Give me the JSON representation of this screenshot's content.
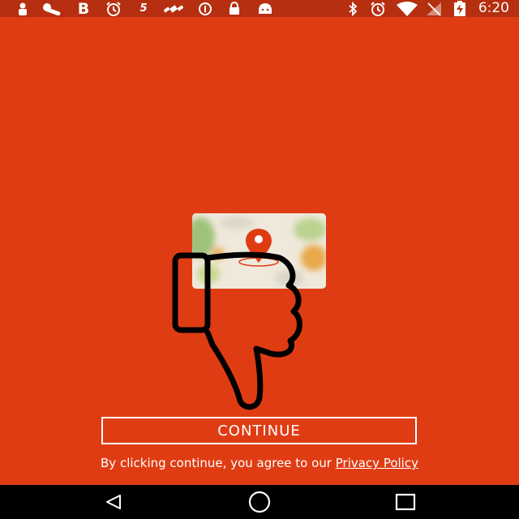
{
  "status_bar": {
    "time": "6:20",
    "left_icons": [
      "person-icon",
      "wrench-icon",
      "b-icon",
      "alarm-icon",
      "five-icon",
      "satellite-icon",
      "info-icon",
      "lock-icon",
      "android-icon"
    ],
    "right_icons": [
      "bluetooth-icon",
      "alarm-icon",
      "wifi-icon",
      "signal-off-icon",
      "battery-charging-icon"
    ],
    "left_glyphs": {
      "b": "B",
      "five": "5"
    }
  },
  "main": {
    "continue_label": "CONTINUE",
    "legal_prefix": "By clicking continue, you agree to our ",
    "privacy_link": "Privacy Policy"
  },
  "colors": {
    "background": "#e03c14",
    "status_bar": "#b52f10",
    "pin": "#e03c14",
    "text": "#ffffff"
  }
}
